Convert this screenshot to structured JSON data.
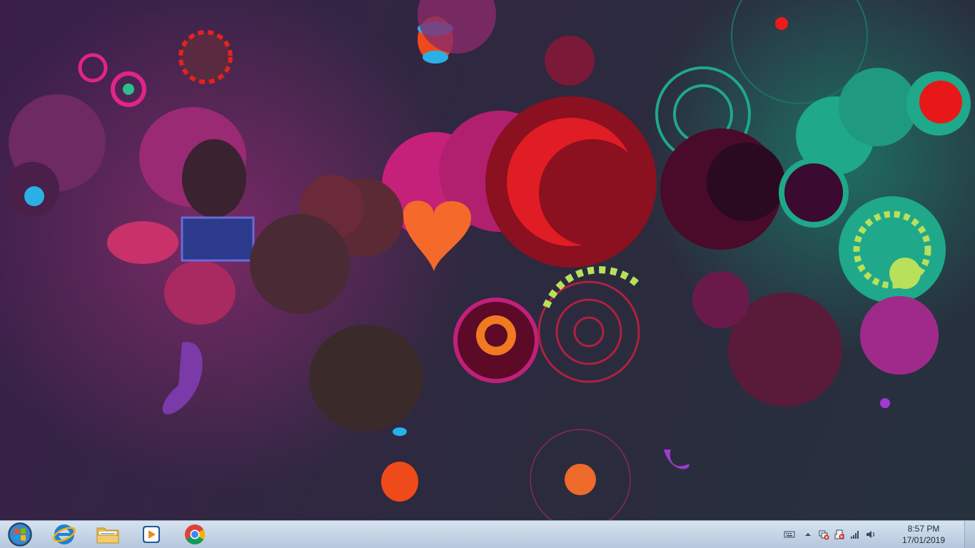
{
  "desktop": {
    "wallpaper": "abstract-colorful-swirls"
  },
  "taskbar": {
    "start_button": "windows-start-orb",
    "pinned": [
      {
        "name": "internet-explorer",
        "icon": "ie-icon"
      },
      {
        "name": "windows-explorer",
        "icon": "folder-icon"
      },
      {
        "name": "windows-media-player",
        "icon": "media-player-icon"
      },
      {
        "name": "google-chrome",
        "icon": "chrome-icon"
      }
    ],
    "tray": {
      "icons": [
        "keyboard-icon",
        "chevron-up-icon",
        "network-error-icon",
        "action-center-icon",
        "signal-icon",
        "volume-icon"
      ],
      "time": "8:57 PM",
      "date": "17/01/2019"
    }
  },
  "colors": {
    "taskbar_top": "#d7e3ef",
    "taskbar_bottom": "#b4c7dc",
    "accent_pink": "#e8187a",
    "accent_teal": "#1fa88a",
    "accent_red": "#e11a1a"
  }
}
